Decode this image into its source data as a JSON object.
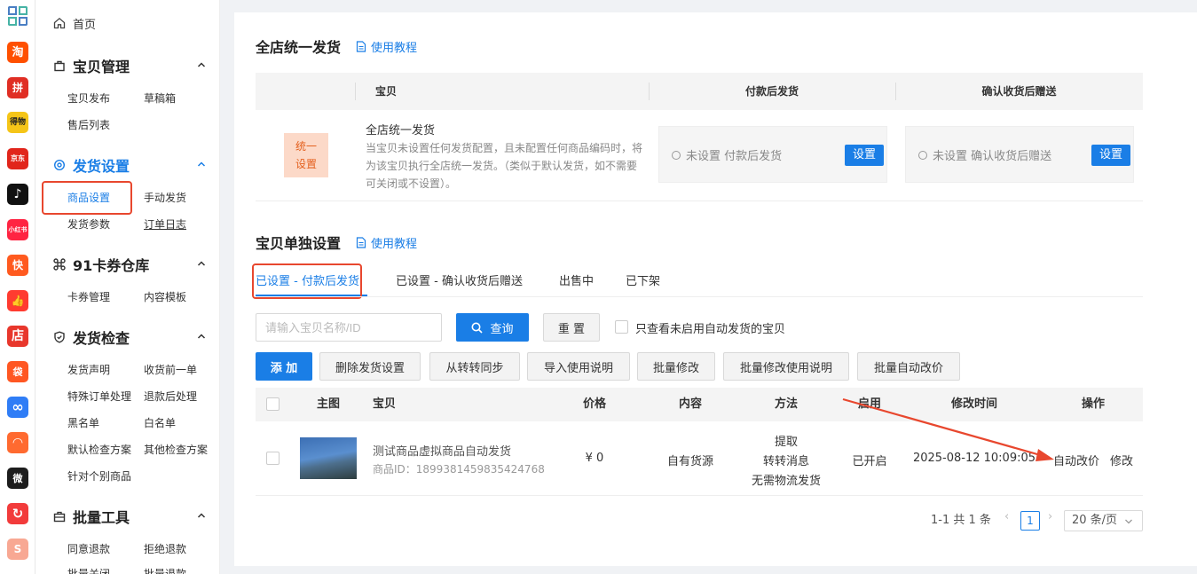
{
  "app_rail": {
    "icons": [
      {
        "name": "brand-grid-logo",
        "label": "",
        "color": "#4a7fc4"
      },
      {
        "name": "taobao-app-icon",
        "label": "淘",
        "color": "#ff5000"
      },
      {
        "name": "pinduoduo-app-icon",
        "label": "拼",
        "color": "#e02e24"
      },
      {
        "name": "dewu-app-icon",
        "label": "得物",
        "color": "#f5c518"
      },
      {
        "name": "jd-app-icon",
        "label": "京东",
        "color": "#e1251b"
      },
      {
        "name": "douyin-app-icon",
        "label": "♪",
        "color": "#111111"
      },
      {
        "name": "xiaohongshu-app-icon",
        "label": "小红书",
        "color": "#ff2442"
      },
      {
        "name": "kuaishou-app-icon",
        "label": "快",
        "color": "#ff5a1f"
      },
      {
        "name": "thumbs-app-icon",
        "label": "👍",
        "color": "#ff3b30"
      },
      {
        "name": "store-app-icon",
        "label": "店",
        "color": "#e8372c"
      },
      {
        "name": "shopping-bag-app-icon",
        "label": "袋",
        "color": "#ff5722"
      },
      {
        "name": "link-app-icon",
        "label": "∞",
        "color": "#2f7df6"
      },
      {
        "name": "mascot-app-icon",
        "label": "◠",
        "color": "#ff6a30"
      },
      {
        "name": "weimob-app-icon",
        "label": "微",
        "color": "#1d1d1d"
      },
      {
        "name": "refresh-app-icon",
        "label": "↻",
        "color": "#f23b3b"
      },
      {
        "name": "shopee-app-icon",
        "label": "S",
        "color": "#f8a893"
      }
    ]
  },
  "sidebar": {
    "home": "首页",
    "sections": [
      {
        "title": "宝贝管理",
        "items": [
          "宝贝发布",
          "草稿箱",
          "售后列表"
        ]
      },
      {
        "title": "发货设置",
        "items": [
          "商品设置",
          "手动发货",
          "发货参数",
          "订单日志"
        ]
      },
      {
        "title": "91卡券仓库",
        "items": [
          "卡券管理",
          "内容模板"
        ]
      },
      {
        "title": "发货检查",
        "items": [
          "发货声明",
          "收货前一单",
          "特殊订单处理",
          "退款后处理",
          "黑名单",
          "白名单",
          "默认检查方案",
          "其他检查方案",
          "针对个别商品"
        ]
      },
      {
        "title": "批量工具",
        "items": [
          "同意退款",
          "拒绝退款",
          "批量关闭",
          "批量退款"
        ]
      }
    ]
  },
  "store_unified": {
    "title": "全店统一发货",
    "tutorial": "使用教程",
    "headers": [
      "宝贝",
      "付款后发货",
      "确认收货后赠送"
    ],
    "badge": "统一设置",
    "badge_line1": "统一",
    "badge_line2": "设置",
    "desc_title": "全店统一发货",
    "desc_body": "当宝贝未设置任何发货配置，且未配置任何商品编码时，将为该宝贝执行全店统一发货。（类似于默认发货，如不需要可关闭或不设置）。",
    "pay_status": "未设置 付款后发货",
    "confirm_status": "未设置 确认收货后赠送",
    "set_button": "设置"
  },
  "single_item": {
    "title": "宝贝单独设置",
    "tutorial": "使用教程",
    "tabs": [
      "已设置 - 付款后发货",
      "已设置 - 确认收货后赠送",
      "出售中",
      "已下架"
    ],
    "search_placeholder": "请输入宝贝名称/ID",
    "query_button": "查询",
    "reset_button": "重 置",
    "only_unenabled_label": "只查看未启用自动发货的宝贝",
    "actions": [
      "添 加",
      "删除发货设置",
      "从转转同步",
      "导入使用说明",
      "批量修改",
      "批量修改使用说明",
      "批量自动改价"
    ],
    "columns": [
      "主图",
      "宝贝",
      "价格",
      "内容",
      "方法",
      "启用",
      "修改时间",
      "操作"
    ],
    "rows": [
      {
        "name": "测试商品虚拟商品自动发货",
        "id": "商品ID：1899381459835424768",
        "price": "¥ 0",
        "content": "自有货源",
        "method": [
          "提取",
          "转转消息",
          "无需物流发货"
        ],
        "enabled": "已开启",
        "modified": "2025-08-12 10:09:05",
        "op_auto_price": "自动改价",
        "op_edit": "修改"
      }
    ],
    "pagination": {
      "summary": "1-1 共 1 条",
      "current": "1",
      "page_size": "20 条/页"
    }
  },
  "colors": {
    "accent": "#1a7ee6",
    "annotation_red": "#e8472e",
    "badge_bg": "#fcd9c8",
    "badge_text": "#e4601e"
  }
}
